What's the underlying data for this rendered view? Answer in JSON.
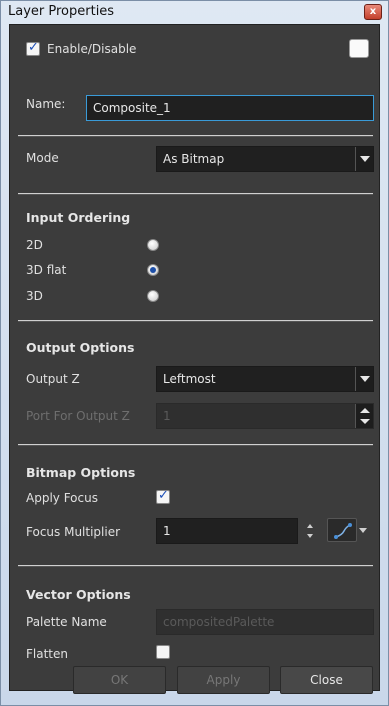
{
  "window": {
    "title": "Layer Properties",
    "close_glyph": "x"
  },
  "enable": {
    "label": "Enable/Disable",
    "checked": true
  },
  "name": {
    "label": "Name:",
    "value": "Composite_1"
  },
  "mode": {
    "label": "Mode",
    "value": "As Bitmap"
  },
  "input_ordering": {
    "title": "Input Ordering",
    "options": [
      {
        "label": "2D",
        "selected": false
      },
      {
        "label": "3D flat",
        "selected": true
      },
      {
        "label": "3D",
        "selected": false
      }
    ]
  },
  "output_options": {
    "title": "Output Options",
    "output_z_label": "Output Z",
    "output_z_value": "Leftmost",
    "port_label": "Port For Output Z",
    "port_value": "1"
  },
  "bitmap_options": {
    "title": "Bitmap Options",
    "apply_focus_label": "Apply Focus",
    "apply_focus_checked": true,
    "focus_multiplier_label": "Focus Multiplier",
    "focus_multiplier_value": "1"
  },
  "vector_options": {
    "title": "Vector Options",
    "palette_label": "Palette Name",
    "palette_placeholder": "compositedPalette",
    "flatten_label": "Flatten",
    "flatten_checked": false
  },
  "buttons": {
    "ok": "OK",
    "apply": "Apply",
    "close": "Close"
  },
  "colors": {
    "panel": "#3c3c3c",
    "accent": "#3a9bd8",
    "title_bg": "#cfdcec"
  }
}
